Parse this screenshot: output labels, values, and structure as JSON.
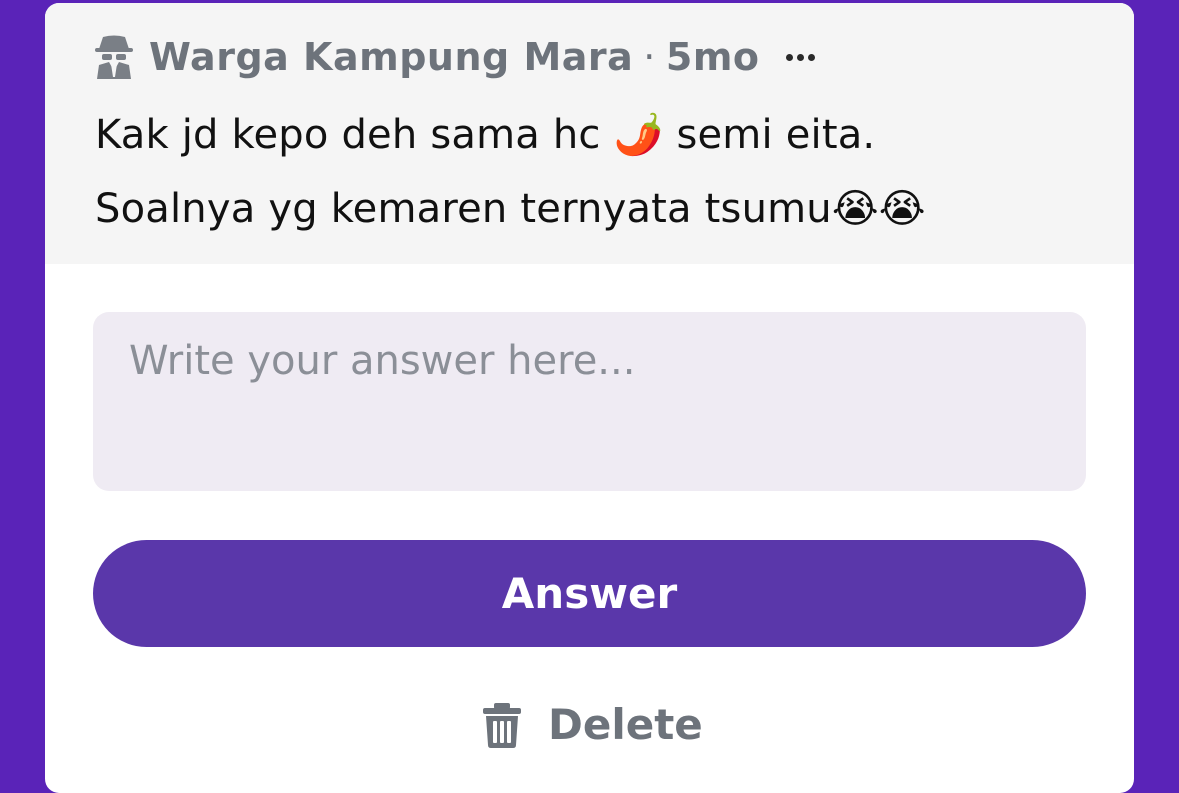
{
  "post": {
    "author": "Warga Kampung Mara",
    "separator": "·",
    "age": "5mo",
    "line1_a": "Kak jd kepo deh sama hc ",
    "line1_emoji": "🌶️",
    "line1_b": " semi eita.",
    "line2_text": "Soalnya yg kemaren ternyata tsumu",
    "line2_emoji": "😭😭"
  },
  "answer": {
    "placeholder": "Write your answer here...",
    "value": "",
    "button_label": "Answer"
  },
  "actions": {
    "delete_label": "Delete"
  },
  "icons": {
    "author": "detective-icon",
    "more": "more-horizontal-icon",
    "delete": "trash-icon"
  },
  "colors": {
    "background": "#5a23b8",
    "button": "#5a37aa",
    "muted_text": "#6d737b",
    "input_bg": "#efebf3"
  }
}
